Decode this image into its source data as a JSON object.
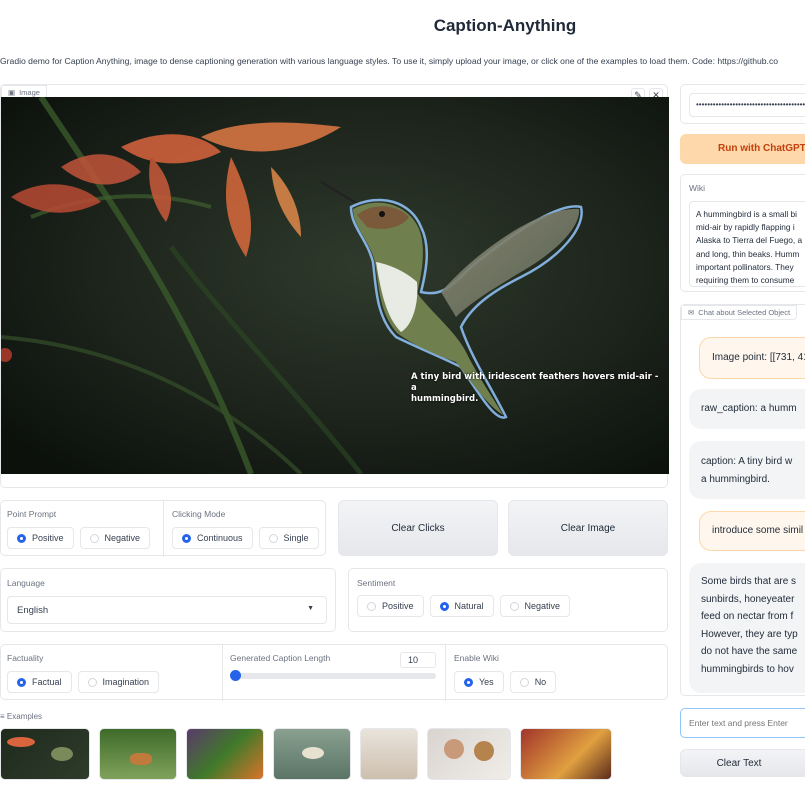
{
  "app": {
    "title": "Caption-Anything",
    "description": "Gradio demo for Caption Anything, image to dense captioning generation with various language styles. To use it, simply upload your image, or click one of the examples to load them. Code: https://github.co"
  },
  "image_panel": {
    "label": "Image",
    "caption_line1": "A tiny bird with iridescent feathers hovers mid-air - a",
    "caption_line2": "hummingbird."
  },
  "point_prompt": {
    "label": "Point Prompt",
    "options": [
      "Positive",
      "Negative"
    ],
    "selected": "Positive"
  },
  "clicking_mode": {
    "label": "Clicking Mode",
    "options": [
      "Continuous",
      "Single"
    ],
    "selected": "Continuous"
  },
  "buttons": {
    "clear_clicks": "Clear Clicks",
    "clear_image": "Clear Image",
    "run_chatgpt": "Run with ChatGPT",
    "clear_text": "Clear Text"
  },
  "language": {
    "label": "Language",
    "value": "English"
  },
  "sentiment": {
    "label": "Sentiment",
    "options": [
      "Positive",
      "Natural",
      "Negative"
    ],
    "selected": "Natural"
  },
  "factuality": {
    "label": "Factuality",
    "options": [
      "Factual",
      "Imagination"
    ],
    "selected": "Factual"
  },
  "caption_length": {
    "label": "Generated Caption Length",
    "value": "10",
    "fraction": 0.0
  },
  "enable_wiki": {
    "label": "Enable Wiki",
    "options": [
      "Yes",
      "No"
    ],
    "selected": "Yes"
  },
  "examples": {
    "label": "Examples"
  },
  "right": {
    "api_key_mask": "••••••••••••••••••••••••••••••••••••••••••••••••",
    "wiki_label": "Wiki",
    "wiki_lines": [
      "A hummingbird is a small bi",
      "mid-air by rapidly flapping i",
      "Alaska to Tierra del Fuego, a",
      "and long, thin beaks. Humm",
      "important pollinators. They",
      "requiring them to consume"
    ],
    "chat_label": "Chat about Selected Object",
    "messages": [
      {
        "role": "user",
        "lines": [
          "Image point: [[731, 41"
        ]
      },
      {
        "role": "bot",
        "lines": [
          "raw_caption: a humm"
        ]
      },
      {
        "role": "bot",
        "lines": [
          "caption: A tiny bird w",
          "a hummingbird."
        ]
      },
      {
        "role": "user",
        "lines": [
          "introduce some simil"
        ]
      },
      {
        "role": "bot",
        "lines": [
          "Some birds that are s",
          "sunbirds, honeyeater",
          "feed on nectar from f",
          "However, they are typ",
          "do not have the same",
          "hummingbirds to hov"
        ]
      }
    ],
    "chat_placeholder": "Enter text and press Enter"
  },
  "colors": {
    "accent": "#2563eb",
    "run_button": "#fed7aa",
    "run_text": "#c2410c"
  }
}
